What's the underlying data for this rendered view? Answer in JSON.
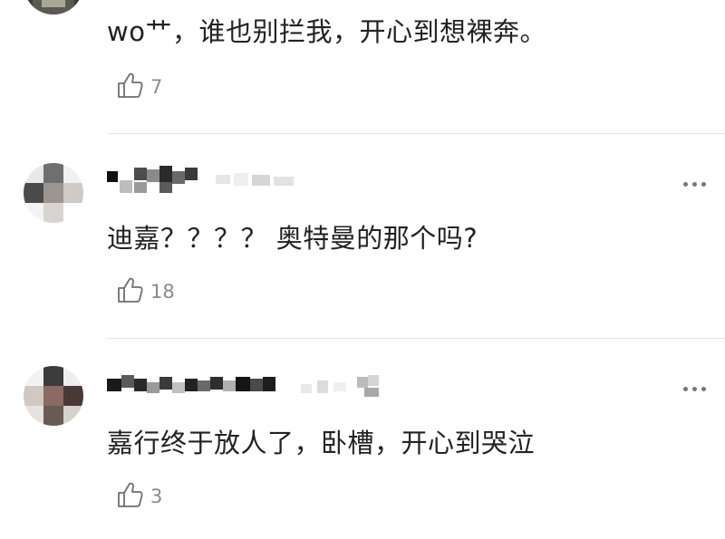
{
  "comments": [
    {
      "text": "wo艹，谁也别拦我，开心到想裸奔。",
      "likes": "7",
      "username_visible": false
    },
    {
      "text": "迪嘉？？？？ 奥特曼的那个吗?",
      "likes": "18",
      "username_visible": false
    },
    {
      "text": "嘉行终于放人了，卧槽，开心到哭泣",
      "likes": "3",
      "username_visible": false
    }
  ],
  "icons": {
    "like": "thumbs-up-outline-icon",
    "more": "ellipsis-horizontal-icon"
  },
  "colors": {
    "text": "#222222",
    "muted": "#8a8a8a",
    "divider": "#e6e6e6"
  }
}
